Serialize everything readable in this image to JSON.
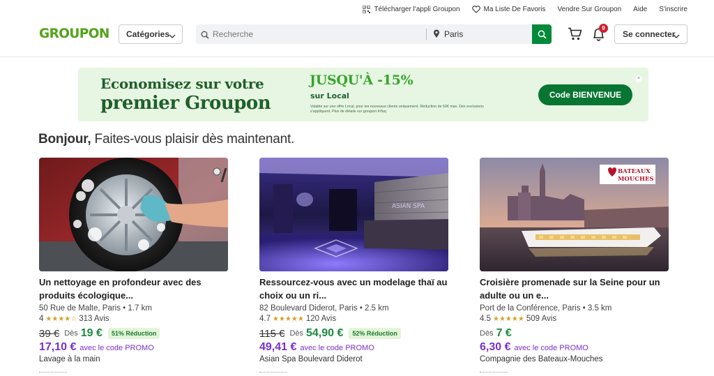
{
  "utility": {
    "app": "Télécharger l'appli Groupon",
    "favorites": "Ma Liste De Favoris",
    "sell": "Vendre Sur Groupon",
    "help": "Aide",
    "signup": "S'inscrire"
  },
  "header": {
    "logo": "GROUPON",
    "categories": "Catégories",
    "search_placeholder": "Recherche",
    "location": "Paris",
    "notif_count": "9",
    "login": "Se connecter"
  },
  "banner": {
    "title1": "Economisez sur votre",
    "title2": "premier Groupon",
    "pct": "JUSQU'À -15%",
    "local": "sur Local",
    "fine": "Valable sur une offre Local, pour les nouveaux clients uniquement. Réduction de 50€ max. Des exclusions s'appliquent. Plus de détails sur groupon.fr/faq",
    "cta": "Code BIENVENUE",
    "close": "×"
  },
  "greeting": {
    "hello": "Bonjour,",
    "text": "Faites-vous plaisir dès maintenant."
  },
  "deals": [
    {
      "title": "Un nettoyage en profondeur avec des produits écologique...",
      "location": "50 Rue de Malte, Paris • 1.7 km",
      "rating": "4",
      "stars": "★★★★☆",
      "reviews": "313 Avis",
      "old_price": "39 €",
      "from": "Dès",
      "price": "19 €",
      "discount": "51% Réduction",
      "promo_price": "17,10 €",
      "promo_text": "avec le code PROMO",
      "merchant": "Lavage à la main"
    },
    {
      "title": "Ressourcez-vous avec un modelage thaï au choix ou un ri...",
      "location": "82 Boulevard Diderot, Paris • 2.5 km",
      "rating": "4.7",
      "stars": "★★★★★",
      "reviews": "120 Avis",
      "old_price": "115 €",
      "from": "Dès",
      "price": "54,90 €",
      "discount": "52% Réduction",
      "promo_price": "49,41 €",
      "promo_text": "avec le code PROMO",
      "merchant": "Asian Spa Boulevard Diderot",
      "sign": "ASIAN SPA"
    },
    {
      "title": "Croisière promenade sur la Seine pour un adulte ou un e...",
      "location": "Port de la Conférence, Paris • 3.5 km",
      "rating": "4.5",
      "stars": "★★★★★",
      "reviews": "509 Avis",
      "old_price": "",
      "from": "Dès",
      "price": "7 €",
      "discount": "",
      "promo_price": "6,30 €",
      "promo_text": "avec le code PROMO",
      "merchant": "Compagnie des Bateaux-Mouches",
      "logo_line1": "BATEAUX",
      "logo_line2": "MOUCHES"
    }
  ],
  "colors": {
    "brand": "#53a318",
    "search_button": "#008a3a",
    "price": "#1a8a3c",
    "promo": "#7a2fd0",
    "badge": "#d01f2d"
  }
}
